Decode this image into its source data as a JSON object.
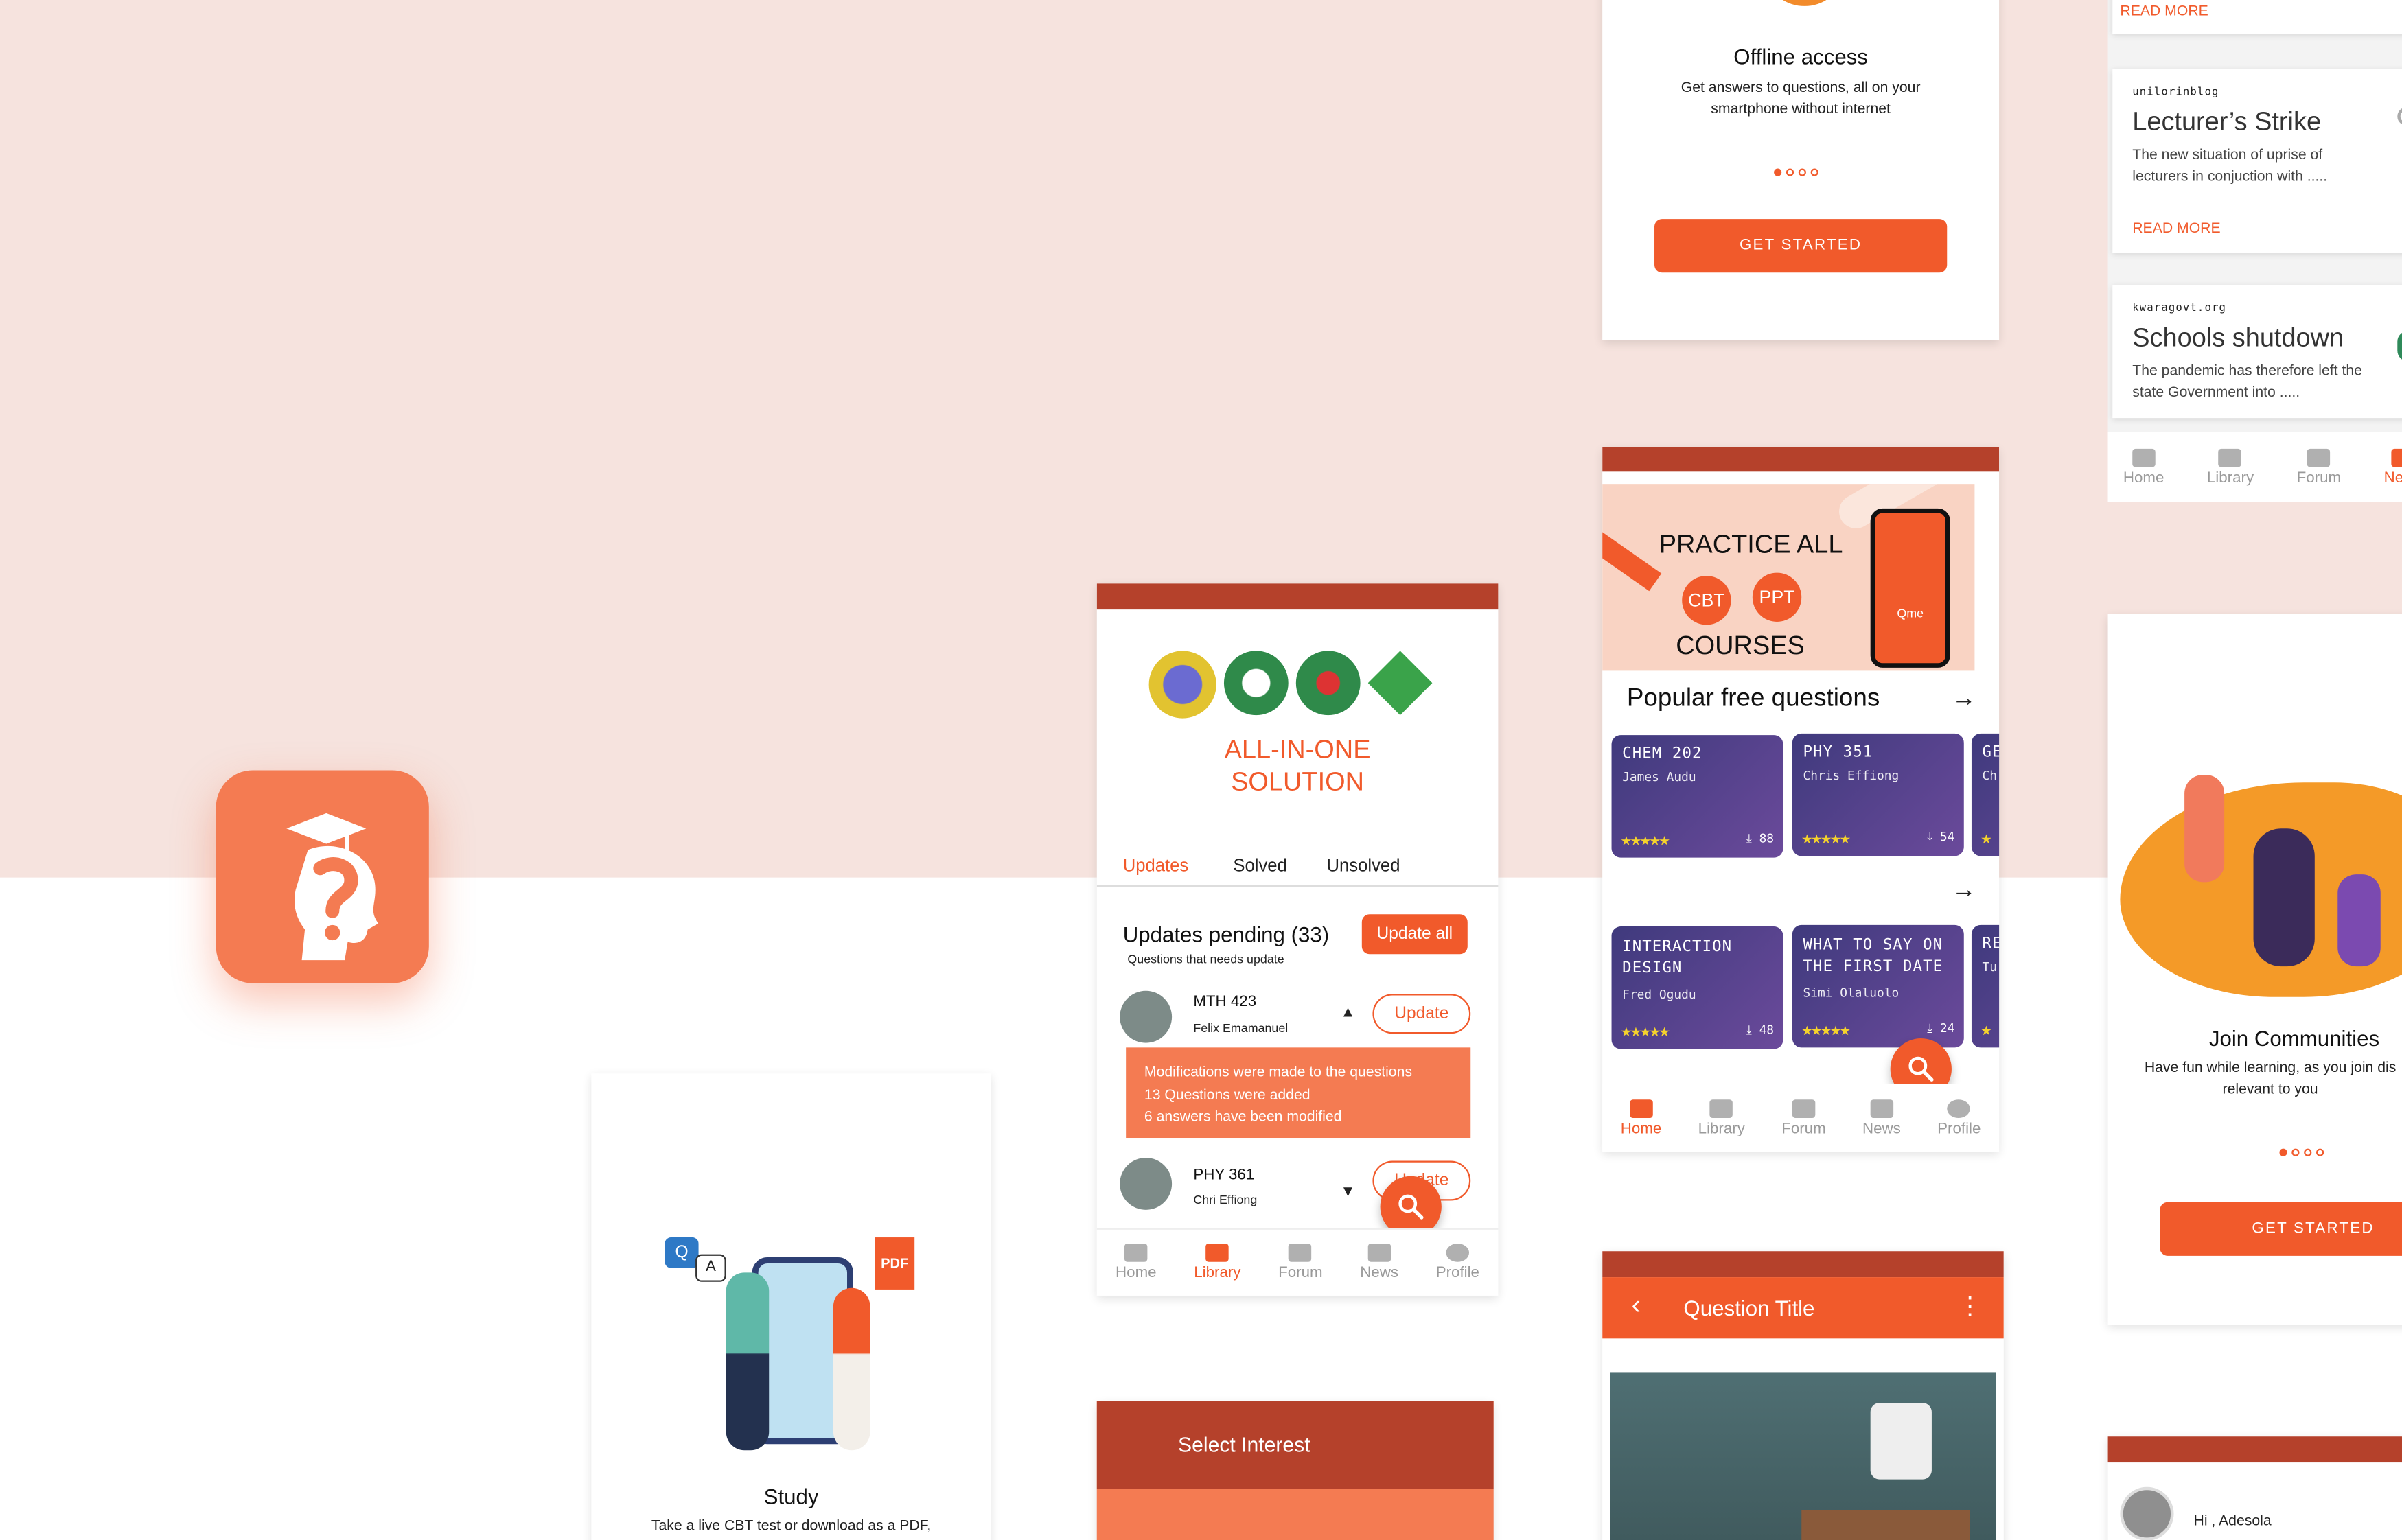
{
  "onboard_offline": {
    "title": "Offline access",
    "body": "Get answers to questions, all on your smartphone without internet",
    "button": "GET STARTED"
  },
  "news": {
    "top_read_more": "READ MORE",
    "items": [
      {
        "source": "unilorinblog",
        "title": "Lecturer’s Strike",
        "excerpt": "The new situation of uprise of lecturers in conjuction with .....",
        "read_more": "READ MORE"
      },
      {
        "source": "kwaragovt.org",
        "title": "Schools shutdown",
        "excerpt": "The pandemic has therefore left the state Government into ....."
      }
    ],
    "nav": [
      "Home",
      "Library",
      "Forum",
      "News"
    ]
  },
  "library": {
    "banner_line1": "ALL-IN-ONE",
    "banner_line2": "SOLUTION",
    "tabs": [
      "Updates",
      "Solved",
      "Unsolved"
    ],
    "pending_title": "Updates pending (33)",
    "pending_sub": "Questions that needs update",
    "update_all": "Update all",
    "items": [
      {
        "code": "MTH 423",
        "author": "Felix Emamanuel",
        "action": "Update",
        "chevron": "▲"
      },
      {
        "code": "PHY 361",
        "author": "Chri Effiong",
        "action": "Update",
        "chevron": "▼"
      }
    ],
    "notice": [
      "Modifications were made to the questions",
      "13 Questions were added",
      "6 answers have been modified"
    ],
    "nav": [
      "Home",
      "Library",
      "Forum",
      "News",
      "Profile"
    ]
  },
  "home": {
    "banner_top": "PRACTICE ALL",
    "banner_bottom": "COURSES",
    "badge1": "CBT",
    "badge2": "PPT",
    "phone_label": "Qme",
    "section_title": "Popular free questions",
    "row1": [
      {
        "code": "CHEM 202",
        "author": "James Audu",
        "stars": "★★★★★",
        "downloads": "88"
      },
      {
        "code": "PHY 351",
        "author": "Chris Effiong",
        "stars": "★★★★★",
        "downloads": "54"
      },
      {
        "code": "GE",
        "author": "Ch",
        "stars": "★",
        "downloads": ""
      }
    ],
    "row2": [
      {
        "code": "INTERACTION DESIGN",
        "author": "Fred Ogudu",
        "stars": "★★★★★",
        "downloads": "48"
      },
      {
        "code": "WHAT TO SAY ON THE FIRST DATE",
        "author": "Simi Olaluolo",
        "stars": "★★★★★",
        "downloads": "24"
      },
      {
        "code": "RE",
        "author": "Tu",
        "stars": "★",
        "downloads": ""
      }
    ],
    "nav": [
      "Home",
      "Library",
      "Forum",
      "News",
      "Profile"
    ]
  },
  "join": {
    "title": "Join Communities",
    "body": "Have fun while learning, as you join dis relevant to you",
    "button": "GET STARTED"
  },
  "study": {
    "title": "Study",
    "body": "Take a live CBT test or download as a PDF,",
    "q": "Q",
    "a": "A",
    "pdf": "PDF"
  },
  "interest": {
    "title": "Select Interest"
  },
  "question": {
    "title": "Question Title",
    "back": "‹",
    "menu": "⋮"
  },
  "profile": {
    "greeting": "Hi , Adesola"
  },
  "colors": {
    "accent": "#f15a2b",
    "rust": "#b5412b",
    "app_icon": "#f47b52",
    "bg_pink": "#f6e3de"
  }
}
